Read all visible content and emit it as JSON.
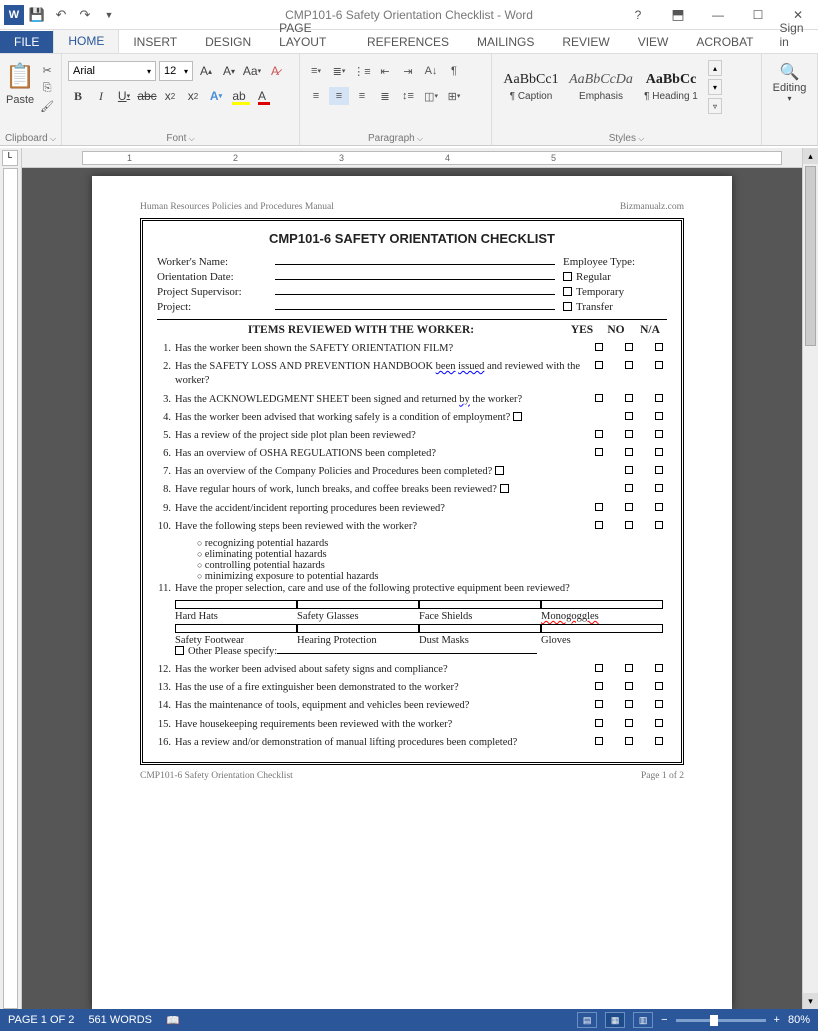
{
  "window": {
    "title": "CMP101-6 Safety Orientation Checklist - Word",
    "signin": "Sign in"
  },
  "tabs": [
    "FILE",
    "HOME",
    "INSERT",
    "DESIGN",
    "PAGE LAYOUT",
    "REFERENCES",
    "MAILINGS",
    "REVIEW",
    "VIEW",
    "ACROBAT"
  ],
  "ribbon": {
    "clipboard": {
      "paste": "Paste",
      "label": "Clipboard"
    },
    "font": {
      "name": "Arial",
      "size": "12",
      "label": "Font"
    },
    "paragraph": {
      "label": "Paragraph"
    },
    "styles": {
      "label": "Styles",
      "items": [
        {
          "sample": "AaBbCc1",
          "name": "¶ Caption",
          "cls": ""
        },
        {
          "sample": "AaBbCcDa",
          "name": "Emphasis",
          "cls": "emph"
        },
        {
          "sample": "AaBbCc",
          "name": "¶ Heading 1",
          "cls": "h1"
        }
      ]
    },
    "editing": {
      "label": "Editing"
    }
  },
  "ruler_marks": [
    "1",
    "2",
    "3",
    "4",
    "5"
  ],
  "doc": {
    "header_left": "Human Resources Policies and Procedures Manual",
    "header_right": "Bizmanualz.com",
    "title": "CMP101-6 SAFETY ORIENTATION CHECKLIST",
    "fields": [
      {
        "label": "Worker's Name:",
        "right": "Employee Type:"
      },
      {
        "label": "Orientation Date:",
        "right_chk": "Regular"
      },
      {
        "label": "Project Supervisor:",
        "right_chk": "Temporary"
      },
      {
        "label": "Project:",
        "right_chk": "Transfer"
      }
    ],
    "section": "ITEMS REVIEWED WITH THE WORKER:",
    "cols": [
      "YES",
      "NO",
      "N/A"
    ],
    "items": [
      {
        "n": "1.",
        "q": "Has the worker been shown the SAFETY ORIENTATION FILM?",
        "cb": 3
      },
      {
        "n": "2.",
        "q": "Has the SAFETY LOSS AND PREVENTION HANDBOOK <span class='squiggle-b'>been</span> <span class='squiggle-b'>issued</span> and reviewed with the worker?",
        "cb": 3
      },
      {
        "n": "3.",
        "q": "Has the ACKNOWLEDGMENT SHEET been signed and returned <span class='squiggle-b'>by</span> the worker?",
        "cb": 3
      },
      {
        "n": "4.",
        "q": "Has the worker been advised that working safely is a condition of employment? <span class='chk'></span>",
        "cb": 2
      },
      {
        "n": "5.",
        "q": "Has a review of the project side plot plan been reviewed?",
        "cb": 3
      },
      {
        "n": "6.",
        "q": "Has an overview of OSHA REGULATIONS been completed?",
        "cb": 3
      },
      {
        "n": "7.",
        "q": "Has an overview of the Company Policies and Procedures been completed? <span class='chk'></span>",
        "cb": 2
      },
      {
        "n": "8.",
        "q": "Have regular hours of work, lunch breaks, and coffee breaks been reviewed? <span class='chk'></span>",
        "cb": 2
      },
      {
        "n": "9.",
        "q": "Have the accident/incident reporting procedures been reviewed?",
        "cb": 3
      },
      {
        "n": "10.",
        "q": "Have the following steps been reviewed with the worker?",
        "cb": 3
      }
    ],
    "subitems": [
      "recognizing potential hazards",
      "eliminating potential hazards",
      "controlling potential hazards",
      "minimizing exposure to potential hazards"
    ],
    "item11": "Have the proper selection, care and use of the following protective equipment been reviewed?",
    "ppe": [
      "Hard Hats",
      "Safety Glasses",
      "Face Shields",
      "<span class='squiggle'>Monogoggles</span>",
      "Safety Footwear",
      "Hearing Protection",
      "Dust Masks",
      "Gloves"
    ],
    "ppe_other": "Other   Please specify:",
    "items2": [
      {
        "n": "12.",
        "q": "Has the worker been advised about safety signs and compliance?",
        "cb": 3
      },
      {
        "n": "13.",
        "q": "Has the use of a fire extinguisher been demonstrated to the worker?",
        "cb": 3
      },
      {
        "n": "14.",
        "q": "Has the maintenance of tools, equipment and vehicles been reviewed?",
        "cb": 3
      },
      {
        "n": "15.",
        "q": "Have housekeeping requirements been reviewed with the worker?",
        "cb": 3
      },
      {
        "n": "16.",
        "q": "Has a review and/or demonstration of manual lifting procedures been completed?",
        "cb": 3
      }
    ],
    "footer_left": "CMP101-6 Safety Orientation Checklist",
    "footer_right": "Page 1 of 2"
  },
  "status": {
    "page": "PAGE 1 OF 2",
    "words": "561 WORDS",
    "zoom": "80%"
  }
}
